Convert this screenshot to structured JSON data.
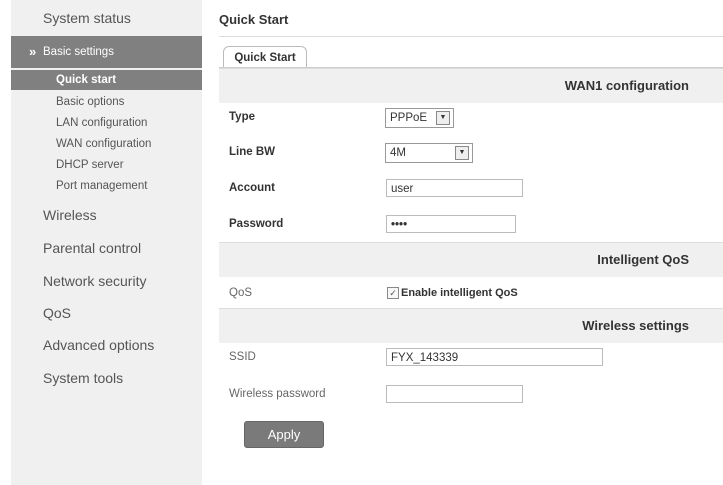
{
  "sidebar": {
    "items": [
      {
        "label": "System status"
      },
      {
        "label": "Basic settings"
      },
      {
        "label": "Wireless"
      },
      {
        "label": "Parental control"
      },
      {
        "label": "Network security"
      },
      {
        "label": "QoS"
      },
      {
        "label": "Advanced options"
      },
      {
        "label": "System tools"
      }
    ],
    "subitems": [
      {
        "label": "Quick start"
      },
      {
        "label": "Basic options"
      },
      {
        "label": "LAN configuration"
      },
      {
        "label": "WAN configuration"
      },
      {
        "label": "DHCP server"
      },
      {
        "label": "Port management"
      }
    ],
    "expand_glyph": "»"
  },
  "main": {
    "title": "Quick Start",
    "tab_label": "Quick Start",
    "sections": {
      "wan": "WAN1 configuration",
      "qos": "Intelligent QoS",
      "wireless": "Wireless settings"
    },
    "fields": {
      "type": {
        "label": "Type",
        "value": "PPPoE"
      },
      "line_bw": {
        "label": "Line BW",
        "value": "4M"
      },
      "account": {
        "label": "Account",
        "value": "user"
      },
      "password": {
        "label": "Password",
        "value": "••••"
      },
      "qos": {
        "label": "QoS",
        "checkbox_label": "Enable intelligent QoS",
        "checked": true
      },
      "ssid": {
        "label": "SSID",
        "value": "FYX_143339"
      },
      "wireless_password": {
        "label": "Wireless password",
        "value": ""
      }
    },
    "apply_label": "Apply"
  }
}
